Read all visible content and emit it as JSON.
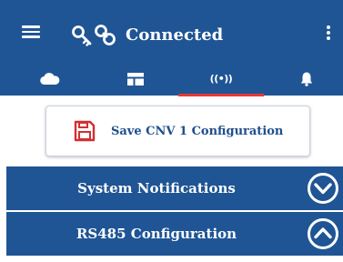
{
  "colors": {
    "primary": "#1f5594",
    "accent_indicator": "#e53935",
    "save_icon_red": "#d32f2f",
    "text_on_primary": "#ffffff",
    "save_label": "#1f4e8c"
  },
  "header": {
    "title": "Connected",
    "menu_icon": "hamburger-menu-icon",
    "status_icon": "key-link-icon",
    "overflow_icon": "more-vert-icon"
  },
  "tabs": [
    {
      "icon": "cloud-icon",
      "selected": false
    },
    {
      "icon": "dashboard-icon",
      "selected": false
    },
    {
      "icon": "wireless-signal-icon",
      "selected": true,
      "glyph": "((•))"
    },
    {
      "icon": "bell-icon",
      "selected": false
    }
  ],
  "save_button": {
    "label": "Save CNV 1 Configuration",
    "icon": "floppy-disk-icon"
  },
  "sections": [
    {
      "title": "System Notifications",
      "icon": "chevron-down-circle-icon",
      "expanded": false
    },
    {
      "title": "RS485 Configuration",
      "icon": "chevron-up-circle-icon",
      "expanded": true
    }
  ]
}
